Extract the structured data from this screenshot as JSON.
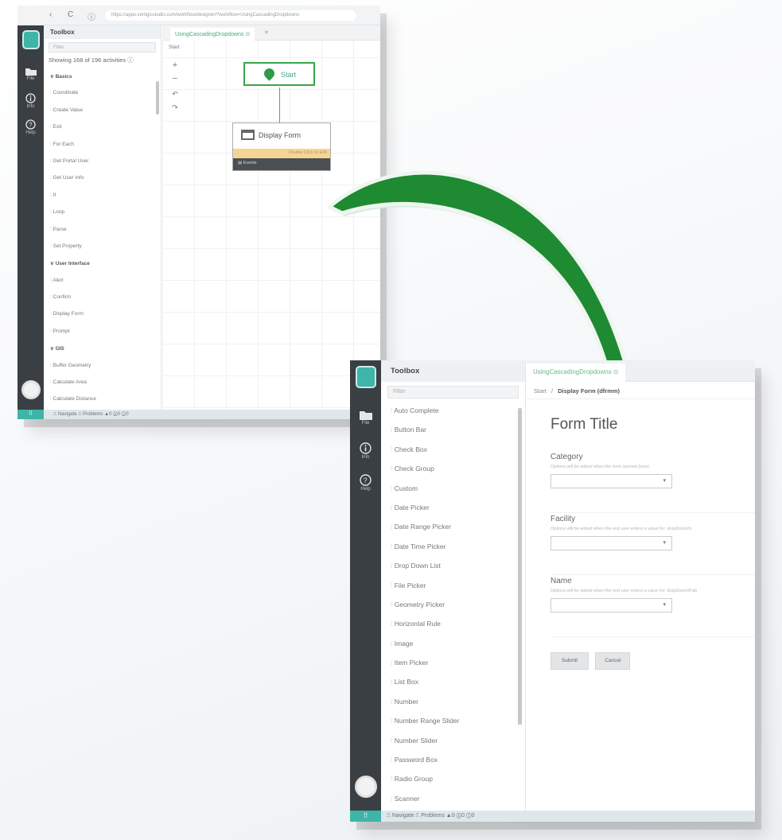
{
  "designer": {
    "browser_address": "https://apps.vertigisstudio.com/workflow/designer/?workflow=UsingCascadingDropdowns",
    "nav_back": "‹",
    "nav_reload": "C",
    "nav_info": "ⓘ",
    "rail": {
      "file": "File",
      "info": "Info",
      "help": "Help"
    },
    "toolbox": {
      "title": "Toolbox",
      "filter_placeholder": "Filter",
      "showing": "Showing 168 of 196 activities ⓘ",
      "categories": [
        {
          "label": "∨ Basics",
          "items": [
            "Coordinate",
            "Create Value",
            "Exit",
            "For Each",
            "Get Portal User",
            "Get User Info",
            "If",
            "Loop",
            "Parse",
            "Set Property"
          ]
        },
        {
          "label": "∨ User Interface",
          "items": [
            "Alert",
            "Confirm",
            "Display Form",
            "Prompt"
          ]
        },
        {
          "label": "∨ GIS",
          "items": [
            "Buffer Geometry",
            "Calculate Area",
            "Calculate Distance"
          ]
        }
      ]
    },
    "tab": "UsingCascadingDropdowns ⊙",
    "tab_close": "✕",
    "crumb": "Start",
    "zoom": [
      "+",
      "−",
      "↶",
      "↷"
    ],
    "node_start": "Start",
    "node_form": "Display Form",
    "node_form_warning": "Double Click to Edit",
    "node_form_footer": "▤ Events",
    "statusbar": "⎍ Navigate  ⎍ Problems  ▲0 ⓧ0 ⓘ0",
    "statusbar_grid": "⠿"
  },
  "preview": {
    "rail": {
      "file": "File",
      "info": "Info",
      "help": "Help"
    },
    "toolbox": {
      "title": "Toolbox",
      "filter_placeholder": "Filter",
      "items": [
        "Auto Complete",
        "Button Bar",
        "Check Box",
        "Check Group",
        "Custom",
        "Date Picker",
        "Date Range Picker",
        "Date Time Picker",
        "Drop Down List",
        "File Picker",
        "Geometry Picker",
        "Horizontal Rule",
        "Image",
        "Item Picker",
        "List Box",
        "Number",
        "Number Range Slider",
        "Number Slider",
        "Password Box",
        "Radio Group",
        "Scanner"
      ]
    },
    "tab": "UsingCascadingDropdowns ⊙",
    "crumb_root": "Start",
    "crumb_sep": "/",
    "crumb_current": "Display Form (dfrmm)",
    "form_title": "Form Title",
    "fields": [
      {
        "label": "Category",
        "hint": "Options will be added when the form opened (loss)"
      },
      {
        "label": "Facility",
        "hint": "Options will be added when the end user enters a value for: dropDown2n"
      },
      {
        "label": "Name",
        "hint": "Options will be added when the end user enters a value for: dropDown3Fab"
      }
    ],
    "select_chevron": "▾",
    "submit_label": "Submit",
    "cancel_label": "Cancel",
    "statusbar": "⎍ Navigate  ⎍ Problems  ▲0 ⓧ0 ⓘ0",
    "statusbar_grid": "⠿"
  },
  "colors": {
    "accent": "#3fb4a8",
    "arrow": "#1e8a32",
    "rail": "#3a3f44"
  }
}
